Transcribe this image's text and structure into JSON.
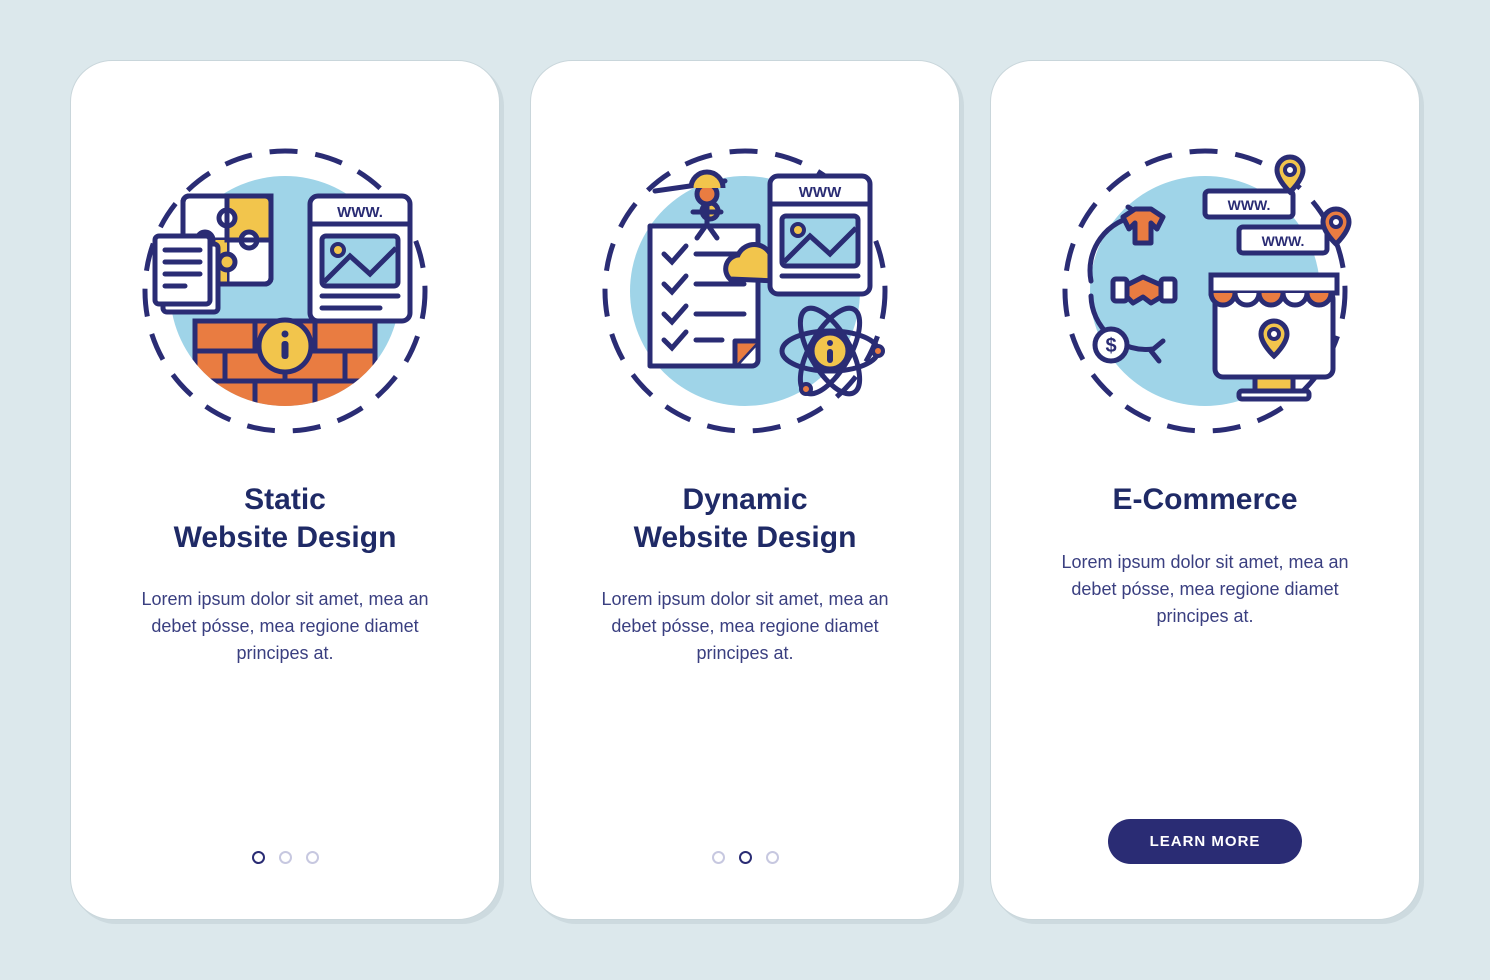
{
  "colors": {
    "navy": "#2a2c74",
    "sky": "#9fd4e8",
    "orange": "#e97c41",
    "yellow": "#f2c54c",
    "line": "#2a2c74"
  },
  "slides": [
    {
      "icon": "static-design",
      "title": "Static\nWebsite Design",
      "body": "Lorem ipsum dolor sit amet, mea an debet pósse, mea regione diamet principes at.",
      "dots": 3,
      "active_dot": 0,
      "cta": null
    },
    {
      "icon": "dynamic-design",
      "title": "Dynamic\nWebsite Design",
      "body": "Lorem ipsum dolor sit amet, mea an debet pósse, mea regione diamet principes at.",
      "dots": 3,
      "active_dot": 1,
      "cta": null
    },
    {
      "icon": "ecommerce",
      "title": "E-Commerce",
      "body": "Lorem ipsum dolor sit amet, mea an debet pósse, mea regione diamet principes at.",
      "dots": 0,
      "active_dot": null,
      "cta": "LEARN MORE"
    }
  ],
  "illustration_labels": {
    "www": "WWW",
    "www_dot": "WWW."
  }
}
